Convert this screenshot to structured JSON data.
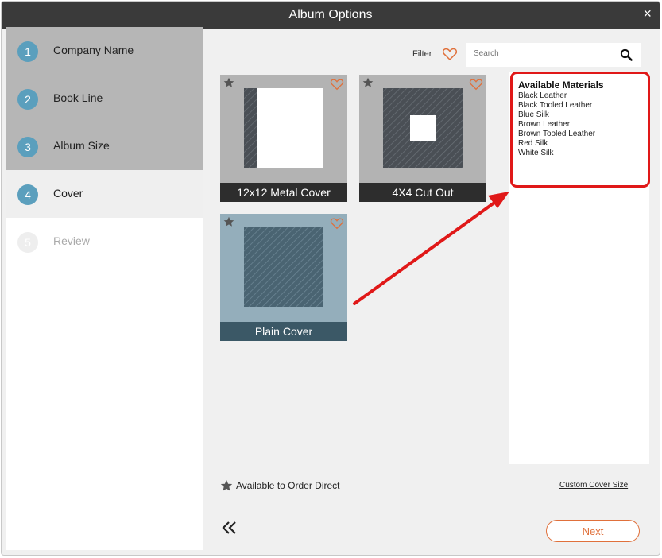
{
  "window": {
    "title": "Album Options",
    "close_label": "×"
  },
  "steps": [
    {
      "num": "1",
      "label": "Company Name"
    },
    {
      "num": "2",
      "label": "Book Line"
    },
    {
      "num": "3",
      "label": "Album Size"
    },
    {
      "num": "4",
      "label": "Cover"
    },
    {
      "num": "5",
      "label": "Review"
    }
  ],
  "filter": {
    "label": "Filter",
    "icon": "heart-outline-icon"
  },
  "search": {
    "placeholder": "Search",
    "value": ""
  },
  "covers": [
    {
      "name": "12x12 Metal Cover"
    },
    {
      "name": "4X4 Cut Out"
    },
    {
      "name": "Plain Cover"
    }
  ],
  "materials": {
    "heading": "Available Materials",
    "items": [
      "Black Leather",
      "Black Tooled Leather",
      "Blue Silk",
      "Brown Leather",
      "Brown Tooled Leather",
      "Red Silk",
      "White Silk"
    ]
  },
  "legend": {
    "label": "Available to Order Direct"
  },
  "custom_size_link": "Custom Cover Size",
  "buttons": {
    "next": "Next"
  },
  "colors": {
    "accent": "#e0703b",
    "step_badge": "#5b9fbd",
    "annotation": "#e01818",
    "titlebar": "#3a3a3a"
  }
}
